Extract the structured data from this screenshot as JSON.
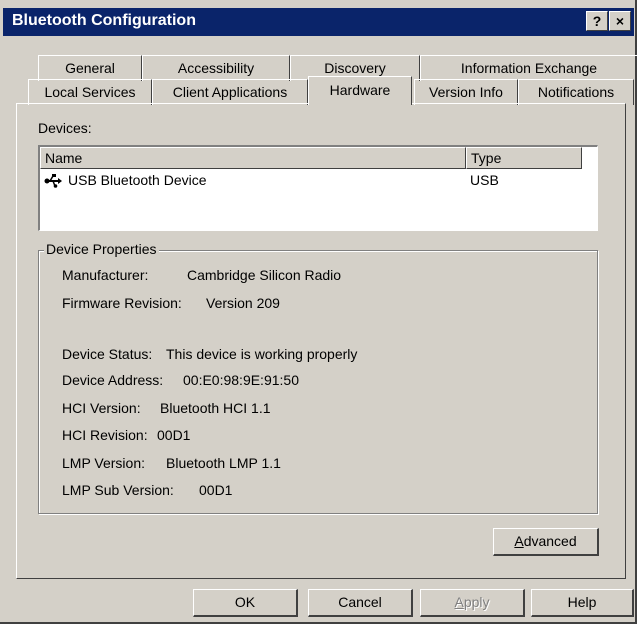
{
  "window": {
    "title": "Bluetooth Configuration",
    "help_glyph": "?",
    "close_glyph": "×"
  },
  "tabs": {
    "row1": [
      "General",
      "Accessibility",
      "Discovery",
      "Information Exchange"
    ],
    "row2": [
      "Local Services",
      "Client Applications",
      "Hardware",
      "Version Info",
      "Notifications"
    ],
    "selected": "Hardware"
  },
  "devices": {
    "label": "Devices:",
    "columns": [
      "Name",
      "Type"
    ],
    "rows": [
      {
        "name": "USB Bluetooth Device",
        "type": "USB",
        "icon": "usb-icon"
      }
    ]
  },
  "properties": {
    "legend": "Device Properties",
    "manufacturer_label": "Manufacturer:",
    "manufacturer": "Cambridge Silicon Radio",
    "firmware_label": "Firmware Revision:",
    "firmware": "Version 209",
    "status_label": "Device Status:",
    "status": "This device is working properly",
    "address_label": "Device Address:",
    "address": "00:E0:98:9E:91:50",
    "hci_version_label": "HCI Version:",
    "hci_version": "Bluetooth HCI 1.1",
    "hci_revision_label": "HCI Revision:",
    "hci_revision": "00D1",
    "lmp_version_label": "LMP Version:",
    "lmp_version": "Bluetooth LMP 1.1",
    "lmp_sub_label": "LMP Sub Version:",
    "lmp_sub": "00D1"
  },
  "buttons": {
    "advanced_first": "A",
    "advanced_rest": "dvanced",
    "ok": "OK",
    "cancel": "Cancel",
    "apply_first": "A",
    "apply_rest": "pply",
    "help": "Help"
  }
}
